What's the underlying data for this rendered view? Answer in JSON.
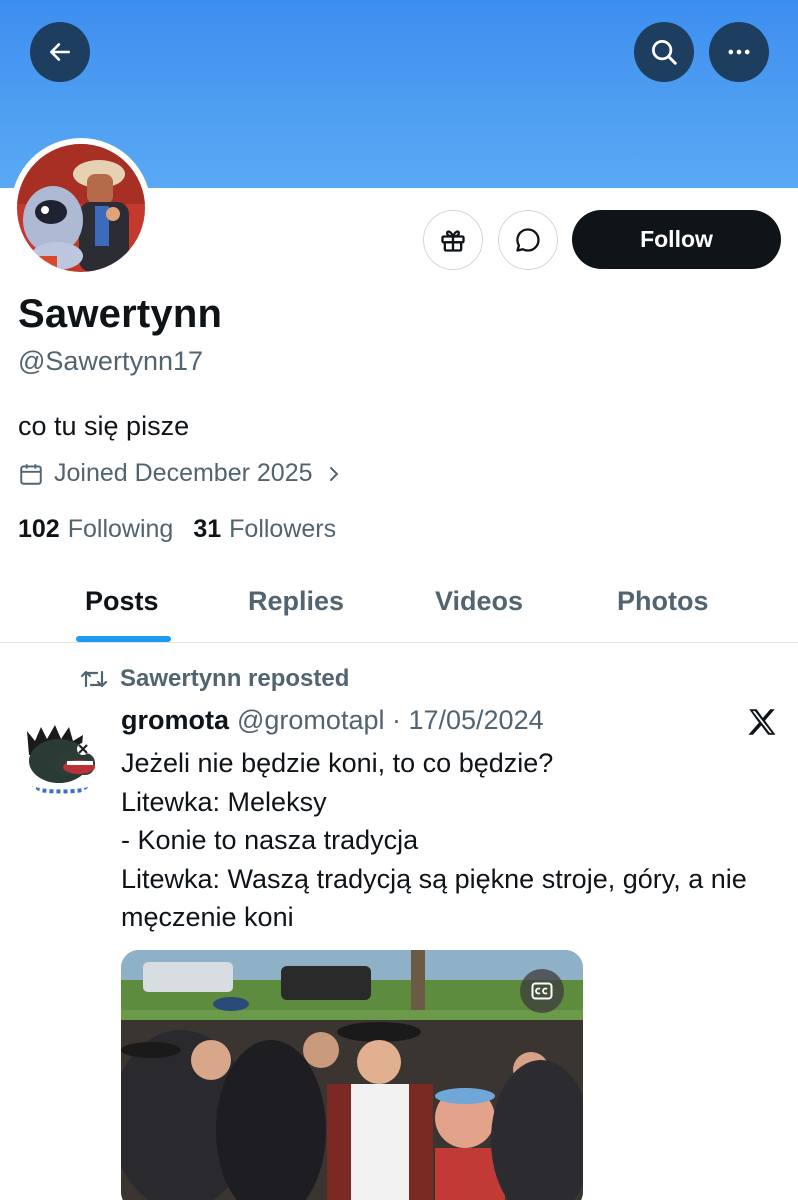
{
  "header": {
    "back_icon": "arrow-left-icon",
    "search_icon": "search-icon",
    "more_icon": "more-horizontal-icon",
    "banner_color": "#4a9af2"
  },
  "profile": {
    "display_name": "Sawertynn",
    "handle": "@Sawertynn17",
    "bio": "co tu się pisze",
    "joined": "Joined December 2025",
    "following_count": "102",
    "following_label": "Following",
    "followers_count": "31",
    "followers_label": "Followers"
  },
  "actions": {
    "gift_icon": "gift-icon",
    "message_icon": "message-bubble-icon",
    "follow_label": "Follow"
  },
  "tabs": [
    {
      "label": "Posts",
      "active": true
    },
    {
      "label": "Replies",
      "active": false
    },
    {
      "label": "Videos",
      "active": false
    },
    {
      "label": "Photos",
      "active": false
    }
  ],
  "feed": {
    "repost_label": "Sawertynn reposted",
    "post": {
      "author": "gromota",
      "handle_date": "@gromotapl · 17/05/2024",
      "source_icon": "x-logo-icon",
      "lines": [
        "Jeżeli nie będzie koni, to co będzie?",
        "Litewka: Meleksy",
        "- Konie to nasza tradycja",
        "Litewka: Waszą tradycją są piękne stroje, góry, a nie męczenie koni"
      ],
      "media_badge_icon": "closed-captions-icon"
    }
  },
  "colors": {
    "accent": "#1d9bf0",
    "text_primary": "#0f1419",
    "text_secondary": "#536471",
    "follow_bg": "#0f1419"
  }
}
